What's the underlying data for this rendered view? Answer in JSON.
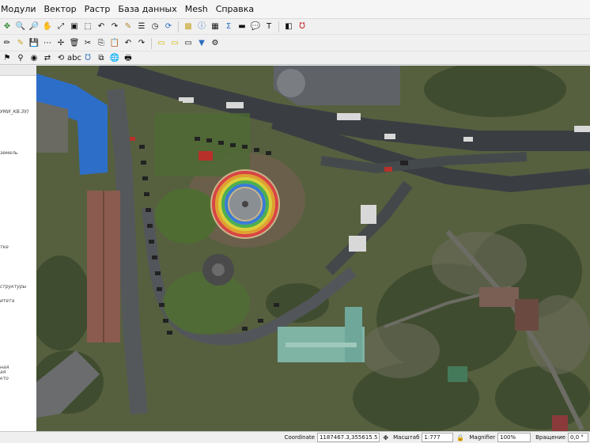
{
  "menu": [
    {
      "label": "Модули"
    },
    {
      "label": "Вектор"
    },
    {
      "label": "Растр"
    },
    {
      "label": "База данных"
    },
    {
      "label": "Mesh"
    },
    {
      "label": "Справка"
    }
  ],
  "panel_texts": [
    "УМИ_КВ.ЗУ)",
    "земель",
    "тке",
    "структуры",
    "итета",
    "ная",
    "ая",
    "кто"
  ],
  "status": {
    "coordinate_label": "Coordinate",
    "coordinate_value": "1187467.3,355615.5",
    "scale_label": "Масштаб",
    "scale_value": "1:777",
    "magnifier_label": "Magnifier",
    "magnifier_value": "100%",
    "rotation_label": "Вращение",
    "rotation_value": "0,0 °"
  },
  "icons": {
    "toolbar1": [
      "add-layer-icon",
      "zoom-in-icon",
      "zoom-out-icon",
      "pan-icon",
      "zoom-full-icon",
      "zoom-layer-icon",
      "zoom-selection-icon",
      "zoom-last-icon",
      "zoom-next-icon",
      "new-bookmark-icon",
      "show-bookmarks-icon",
      "temporal-icon",
      "refresh-icon",
      "annotation-icon",
      "identify-icon",
      "attribute-table-icon",
      "statistics-icon",
      "measure-icon",
      "map-tips-icon",
      "text-annotation-icon",
      "label-icon",
      "python-icon"
    ],
    "toolbar2": [
      "current-edits-icon",
      "toggle-editing-icon",
      "save-edits-icon",
      "digitize-icon",
      "vertex-tool-icon",
      "delete-selected-icon",
      "cut-icon",
      "copy-icon",
      "paste-icon",
      "undo-icon",
      "redo-icon",
      "select-features-icon",
      "select-value-icon",
      "deselect-icon",
      "filter-icon",
      "settings-icon"
    ],
    "toolbar3": [
      "label-tool-icon",
      "pin-labels-icon",
      "show-labels-icon",
      "move-label-icon",
      "rotate-label-icon",
      "change-label-icon",
      "python-console-icon",
      "plugins-icon",
      "globe-icon",
      "print-layout-icon"
    ]
  },
  "colors": {
    "map_bg": "#5a6648",
    "road": "#3b3f42",
    "roof_blue": "#2d6ec9",
    "roof_brick": "#8a5b4e",
    "green_roof": "#6fa89a",
    "tree": "#3c4a2c"
  }
}
